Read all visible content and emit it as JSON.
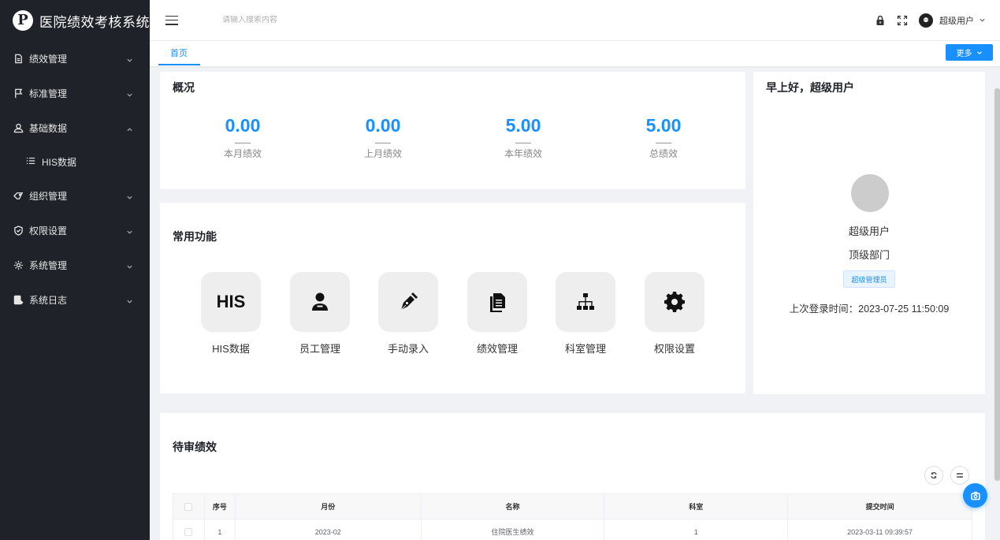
{
  "sidebar": {
    "brand_title": "医院绩效考核系统",
    "items": [
      {
        "label": "绩效管理",
        "icon": "document-icon",
        "expanded": false
      },
      {
        "label": "标准管理",
        "icon": "flag-icon",
        "expanded": false
      },
      {
        "label": "基础数据",
        "icon": "user-icon",
        "expanded": true
      },
      {
        "label": "组织管理",
        "icon": "tag-icon",
        "expanded": false
      },
      {
        "label": "权限设置",
        "icon": "shield-icon",
        "expanded": false
      },
      {
        "label": "系统管理",
        "icon": "gear-icon",
        "expanded": false
      },
      {
        "label": "系统日志",
        "icon": "log-icon",
        "expanded": false
      }
    ],
    "sub_items": [
      {
        "label": "HIS数据",
        "icon": "list-icon"
      }
    ]
  },
  "header": {
    "search_placeholder": "请输入搜索内容",
    "user_name": "超级用户"
  },
  "tabs": {
    "home": "首页",
    "more": "更多"
  },
  "overview": {
    "title": "概况",
    "stats": [
      {
        "value": "0.00",
        "label": "本月绩效"
      },
      {
        "value": "0.00",
        "label": "上月绩效"
      },
      {
        "value": "5.00",
        "label": "本年绩效"
      },
      {
        "value": "5.00",
        "label": "总绩效"
      }
    ]
  },
  "quick": {
    "title": "常用功能",
    "items": [
      {
        "label": "HIS数据",
        "tile_text": "HIS",
        "icon": "his-icon"
      },
      {
        "label": "员工管理",
        "icon": "employee-icon"
      },
      {
        "label": "手动录入",
        "icon": "pen-icon"
      },
      {
        "label": "绩效管理",
        "icon": "file-icon"
      },
      {
        "label": "科室管理",
        "icon": "sitemap-icon"
      },
      {
        "label": "权限设置",
        "icon": "cog-icon"
      }
    ]
  },
  "welcome": {
    "greeting": "早上好，超级用户",
    "name": "超级用户",
    "dept": "顶级部门",
    "role": "超级管理员",
    "last_login": "上次登录时间：2023-07-25 11:50:09"
  },
  "pending": {
    "title": "待审绩效",
    "columns": [
      "序号",
      "月份",
      "名称",
      "科室",
      "提交时间"
    ],
    "rows": [
      [
        "1",
        "2023-02",
        "住院医生绩效",
        "1",
        "2023-03-11 09:39:57"
      ]
    ]
  },
  "colors": {
    "sidebar_bg": "#1f2329",
    "accent": "#1890ff",
    "page_bg": "#f0f2f5"
  }
}
